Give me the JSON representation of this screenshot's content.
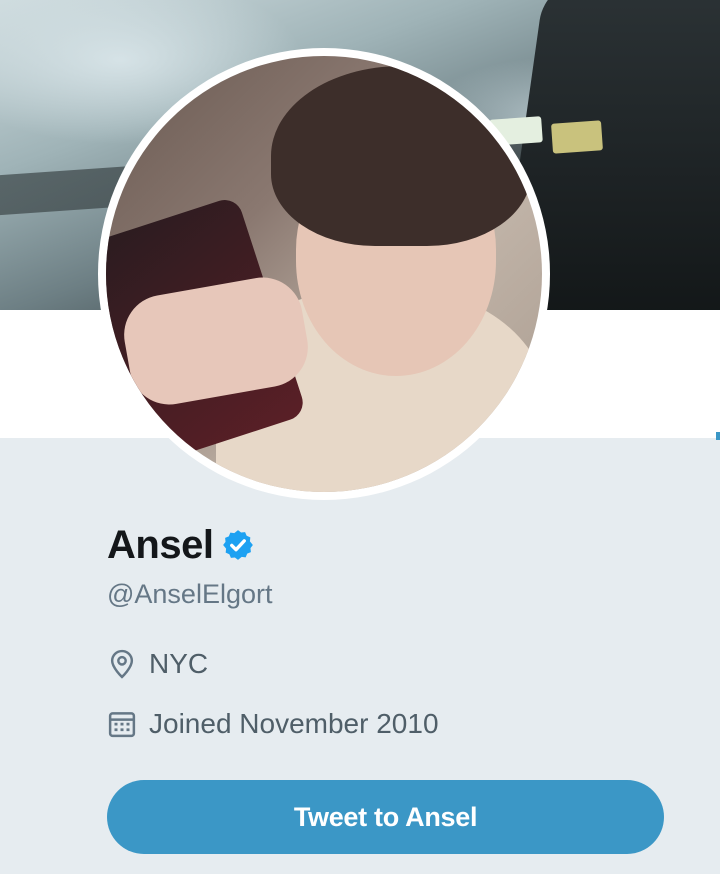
{
  "profile": {
    "display_name": "Ansel",
    "verified": true,
    "handle": "@AnselElgort",
    "location": "NYC",
    "joined": "Joined November 2010"
  },
  "actions": {
    "tweet_to_label": "Tweet to Ansel"
  },
  "icons": {
    "verified": "verified-badge-icon",
    "location": "location-pin-icon",
    "joined": "calendar-icon"
  },
  "colors": {
    "accent": "#3b97c6",
    "page_background": "#e6ecf0",
    "text_primary": "#14171a",
    "text_secondary": "#657786",
    "verified_badge": "#1da1f2"
  }
}
